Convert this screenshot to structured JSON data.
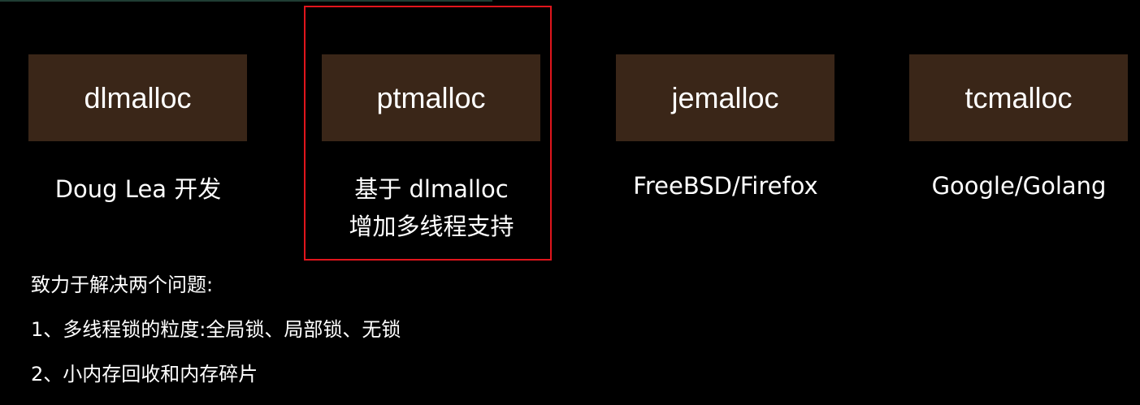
{
  "colors": {
    "background": "#000000",
    "box_fill": "#3a2618",
    "highlight_border": "#e0151c",
    "text": "#ffffff"
  },
  "allocators": [
    {
      "name": "dlmalloc",
      "caption": [
        "Doug Lea 开发"
      ]
    },
    {
      "name": "ptmalloc",
      "caption": [
        "基于 dlmalloc",
        "增加多线程支持"
      ]
    },
    {
      "name": "jemalloc",
      "caption": [
        "FreeBSD/Firefox"
      ]
    },
    {
      "name": "tcmalloc",
      "caption": [
        "Google/Golang"
      ]
    }
  ],
  "notes": {
    "heading": "致力于解决两个问题:",
    "items": [
      "1、多线程锁的粒度:全局锁、局部锁、无锁",
      "2、小内存回收和内存碎片"
    ]
  }
}
